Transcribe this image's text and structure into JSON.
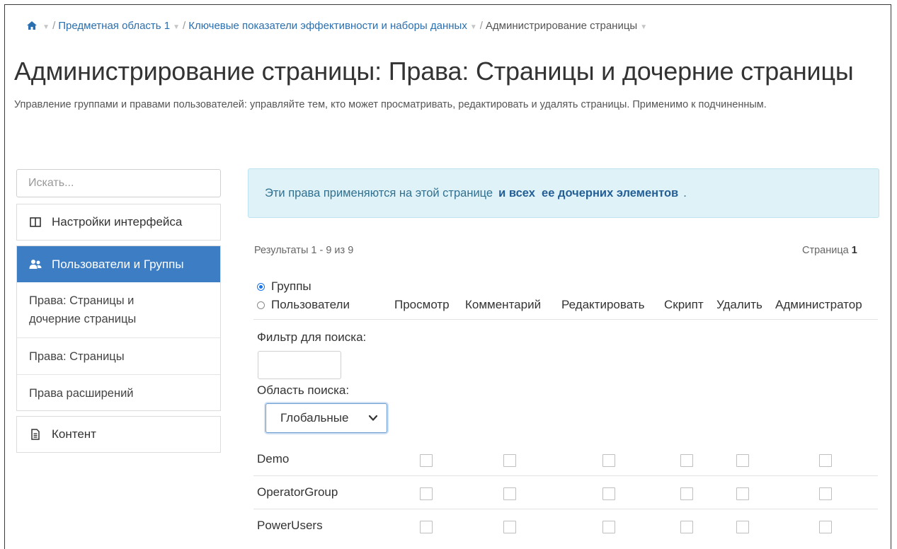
{
  "breadcrumb": {
    "home_icon": "home-icon",
    "items": [
      "Предметная область 1",
      "Ключевые показатели эффективности и наборы данных"
    ],
    "current": "Администрирование страницы"
  },
  "page": {
    "title": "Администрирование страницы: Права: Страницы и дочерние страницы",
    "description": "Управление группами и правами пользователей: управляйте тем, кто может просматривать, редактировать и удалять страницы. Применимо к подчиненным."
  },
  "sidebar": {
    "search_placeholder": "Искать...",
    "interface_settings": {
      "label": "Настройки интерфейса",
      "icon": "columns-icon"
    },
    "users_groups": {
      "label": "Пользователи и Группы",
      "icon": "users-icon"
    },
    "sub_items": [
      "Права: Страницы и дочерние страницы",
      "Права: Страницы",
      "Права расширений"
    ],
    "content": {
      "label": "Контент",
      "icon": "document-icon"
    }
  },
  "info": {
    "text": "Эти права применяются на этой странице",
    "link": "и всех  ее дочерних элементов",
    "end": "."
  },
  "results": {
    "text": "Результаты 1 - 9 из 9",
    "page_label": "Страница",
    "page_number": "1"
  },
  "mode": {
    "groups_label": "Группы",
    "users_label": "Пользователи",
    "selected": "groups"
  },
  "columns": [
    "Просмотр",
    "Комментарий",
    "Редактировать",
    "Скрипт",
    "Удалить",
    "Администратор"
  ],
  "filter": {
    "label": "Фильтр для поиска:",
    "value": ""
  },
  "scope": {
    "label": "Область поиска:",
    "selected": "Глобальные"
  },
  "groups": [
    {
      "name": "Demo",
      "perms": [
        false,
        false,
        false,
        false,
        false,
        false
      ]
    },
    {
      "name": "OperatorGroup",
      "perms": [
        false,
        false,
        false,
        false,
        false,
        false
      ]
    },
    {
      "name": "PowerUsers",
      "perms": [
        false,
        false,
        false,
        false,
        false,
        false
      ]
    }
  ],
  "colors": {
    "accent": "#3c7dc4",
    "link": "#2a6fb0",
    "info_bg": "#dff2f8",
    "info_text": "#31708f"
  }
}
